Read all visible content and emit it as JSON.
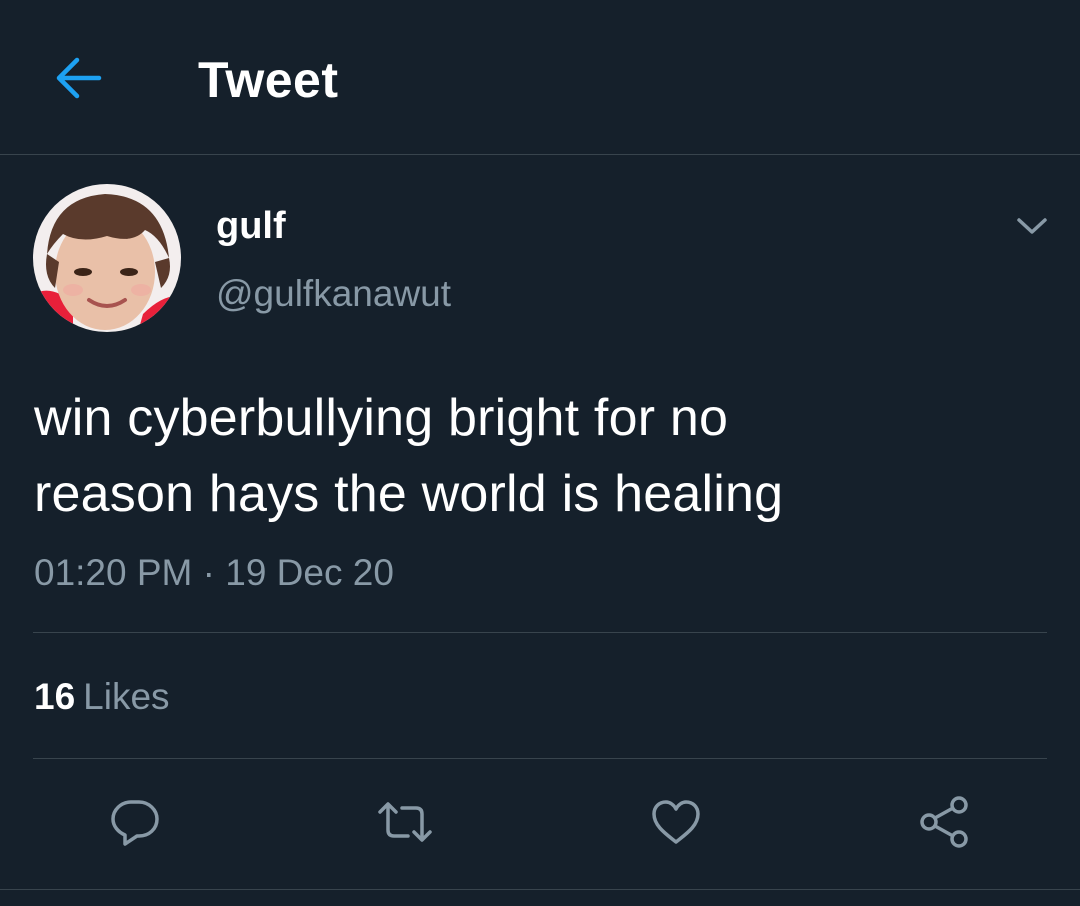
{
  "header": {
    "title": "Tweet",
    "back_icon": "arrow-left-icon"
  },
  "colors": {
    "background": "#15202b",
    "accent": "#1da1f2",
    "secondary_text": "#8899a6",
    "divider": "#38444d"
  },
  "author": {
    "display_name": "gulf",
    "handle": "@gulfkanawut",
    "menu_icon": "chevron-down-icon"
  },
  "tweet": {
    "text_lines": [
      "win cyberbullying bright for no",
      "reason hays the world is healing"
    ],
    "timestamp": "01:20 PM · 19 Dec 20"
  },
  "stats": {
    "likes_count": "16",
    "likes_label": "Likes"
  },
  "actions": [
    {
      "name": "reply",
      "icon": "comment-icon"
    },
    {
      "name": "retweet",
      "icon": "retweet-icon"
    },
    {
      "name": "like",
      "icon": "heart-icon"
    },
    {
      "name": "share",
      "icon": "share-icon"
    }
  ]
}
